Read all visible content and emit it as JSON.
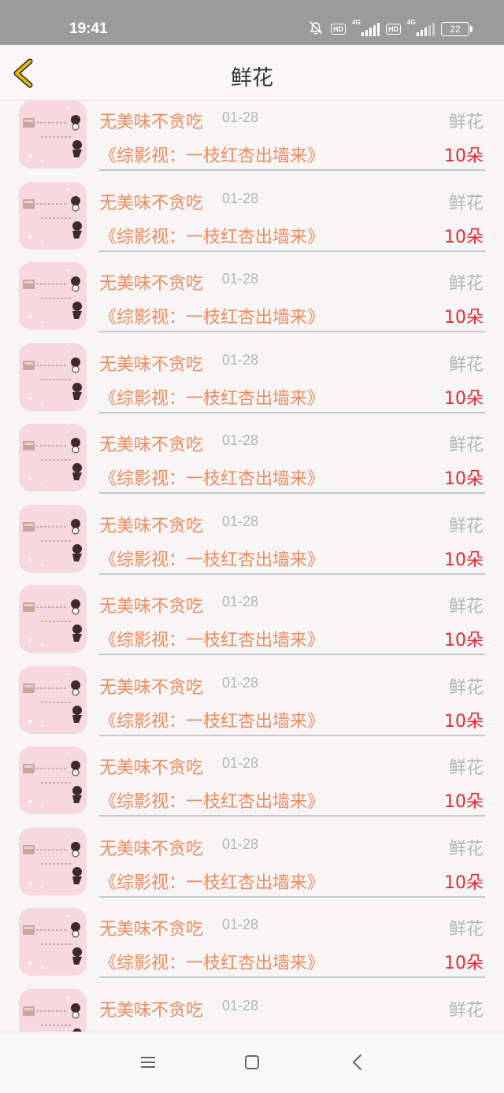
{
  "status_bar": {
    "time": "19:41",
    "hd1": "HD",
    "net1": "4G",
    "hd2": "HD",
    "net2": "4G",
    "battery": "22",
    "icons": [
      "mute-bell-icon",
      "signal-icon",
      "battery-icon"
    ]
  },
  "header": {
    "title": "鲜花",
    "back_icon": "chevron-left-icon",
    "back_color": "#e6b800"
  },
  "items": [
    {
      "user": "无美味不贪吃",
      "date": "01-28",
      "type": "鲜花",
      "book": "《综影视：一枝红杏出墙来》",
      "count": "10朵"
    },
    {
      "user": "无美味不贪吃",
      "date": "01-28",
      "type": "鲜花",
      "book": "《综影视：一枝红杏出墙来》",
      "count": "10朵"
    },
    {
      "user": "无美味不贪吃",
      "date": "01-28",
      "type": "鲜花",
      "book": "《综影视：一枝红杏出墙来》",
      "count": "10朵"
    },
    {
      "user": "无美味不贪吃",
      "date": "01-28",
      "type": "鲜花",
      "book": "《综影视：一枝红杏出墙来》",
      "count": "10朵"
    },
    {
      "user": "无美味不贪吃",
      "date": "01-28",
      "type": "鲜花",
      "book": "《综影视：一枝红杏出墙来》",
      "count": "10朵"
    },
    {
      "user": "无美味不贪吃",
      "date": "01-28",
      "type": "鲜花",
      "book": "《综影视：一枝红杏出墙来》",
      "count": "10朵"
    },
    {
      "user": "无美味不贪吃",
      "date": "01-28",
      "type": "鲜花",
      "book": "《综影视：一枝红杏出墙来》",
      "count": "10朵"
    },
    {
      "user": "无美味不贪吃",
      "date": "01-28",
      "type": "鲜花",
      "book": "《综影视：一枝红杏出墙来》",
      "count": "10朵"
    },
    {
      "user": "无美味不贪吃",
      "date": "01-28",
      "type": "鲜花",
      "book": "《综影视：一枝红杏出墙来》",
      "count": "10朵"
    },
    {
      "user": "无美味不贪吃",
      "date": "01-28",
      "type": "鲜花",
      "book": "《综影视：一枝红杏出墙来》",
      "count": "10朵"
    },
    {
      "user": "无美味不贪吃",
      "date": "01-28",
      "type": "鲜花",
      "book": "《综影视：一枝红杏出墙来》",
      "count": "10朵"
    },
    {
      "user": "无美味不贪吃",
      "date": "01-28",
      "type": "鲜花",
      "book": "",
      "count": ""
    }
  ],
  "nav": {
    "icons": [
      "menu-icon",
      "home-square-icon",
      "back-triangle-icon"
    ]
  },
  "colors": {
    "accent_text": "#f08a5c",
    "count_red": "#e8272f",
    "muted": "#b5b5b5"
  }
}
